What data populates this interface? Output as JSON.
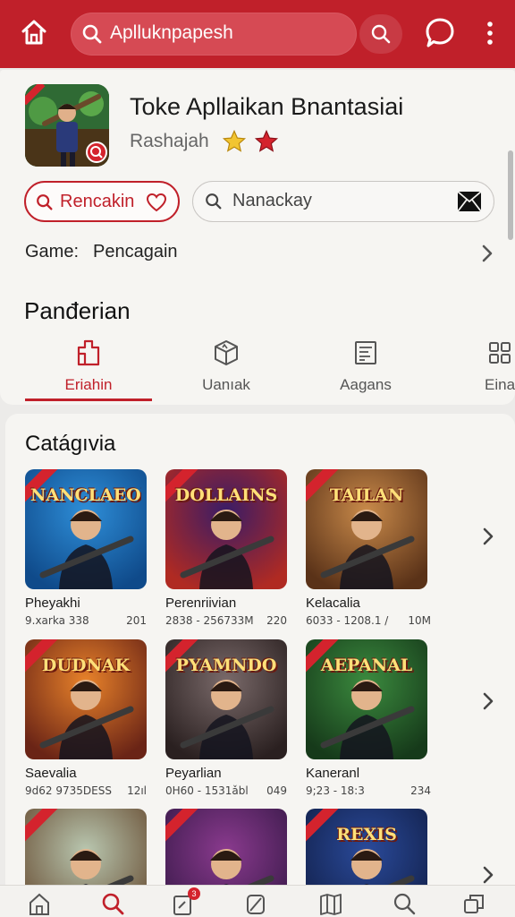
{
  "header": {
    "search_text": "Aplluknpapesh",
    "icons": [
      "home-icon",
      "search-icon",
      "chat-icon",
      "more-vertical-icon"
    ],
    "color": "#c0202a"
  },
  "app": {
    "title": "Toke Apllaikan Bnantasiai",
    "developer": "Rashajah",
    "action_button_label": "Rencakin",
    "search_field_text": "Nanackay",
    "game_label": "Game:",
    "game_value": "Pencagain"
  },
  "section": {
    "title": "Panđerian",
    "tabs": [
      {
        "label": "Eriahin",
        "icon": "puzzle-icon",
        "active": true
      },
      {
        "label": "Uanıak",
        "icon": "box-icon",
        "active": false
      },
      {
        "label": "Aagans",
        "icon": "document-icon",
        "active": false
      },
      {
        "label": "Eina",
        "icon": "grid-icon",
        "active": false
      }
    ]
  },
  "category": {
    "title": "Catágıvia",
    "rows": [
      [
        {
          "thumb_title": "NANCLAEOH",
          "name": "Pheyakhi",
          "meta_left": "9.xarka 338",
          "meta_right": "201",
          "palette": [
            "#2e8ed8",
            "#0f4a8a"
          ]
        },
        {
          "thumb_title": "DOLLAINS",
          "name": "Perenriivian",
          "meta_left": "2838 - 256733M",
          "meta_right": "220",
          "palette": [
            "#3a1c66",
            "#b02a22"
          ]
        },
        {
          "thumb_title": "TAILAN",
          "name": "Kelacalia",
          "meta_left": "6033 - 1208.1 /",
          "meta_right": "10M",
          "palette": [
            "#c98a4a",
            "#5a3218"
          ]
        }
      ],
      [
        {
          "thumb_title": "DUDNAK",
          "name": "Saevalia",
          "meta_left": "9d62 9735DESS",
          "meta_right": "12ıl",
          "palette": [
            "#e8822a",
            "#6a2416"
          ]
        },
        {
          "thumb_title": "PYAMNDO",
          "name": "Peyarlian",
          "meta_left": "0H60 - 1531ǎbl",
          "meta_right": "049",
          "palette": [
            "#7a6a6a",
            "#2a2020"
          ]
        },
        {
          "thumb_title": "AEPANAL",
          "name": "Kaneranl",
          "meta_left": "9;23 - 18:3",
          "meta_right": "234",
          "palette": [
            "#3b8a3e",
            "#163a1a"
          ]
        }
      ],
      [
        {
          "thumb_title": "",
          "name": "",
          "meta_left": "",
          "meta_right": "",
          "palette": [
            "#b9c7b0",
            "#6a5036"
          ]
        },
        {
          "thumb_title": "",
          "name": "",
          "meta_left": "",
          "meta_right": "",
          "palette": [
            "#8a3a8e",
            "#3a1a4a"
          ]
        },
        {
          "thumb_title": "REXIS",
          "name": "",
          "meta_left": "",
          "meta_right": "",
          "palette": [
            "#2a4a9a",
            "#12204a"
          ]
        }
      ]
    ]
  },
  "bottom_nav": {
    "items": [
      "home-icon",
      "search-icon",
      "clipboard-icon",
      "compass-icon",
      "book-icon",
      "search-icon",
      "copy-icon"
    ],
    "badge": "3",
    "active_index": 1
  }
}
